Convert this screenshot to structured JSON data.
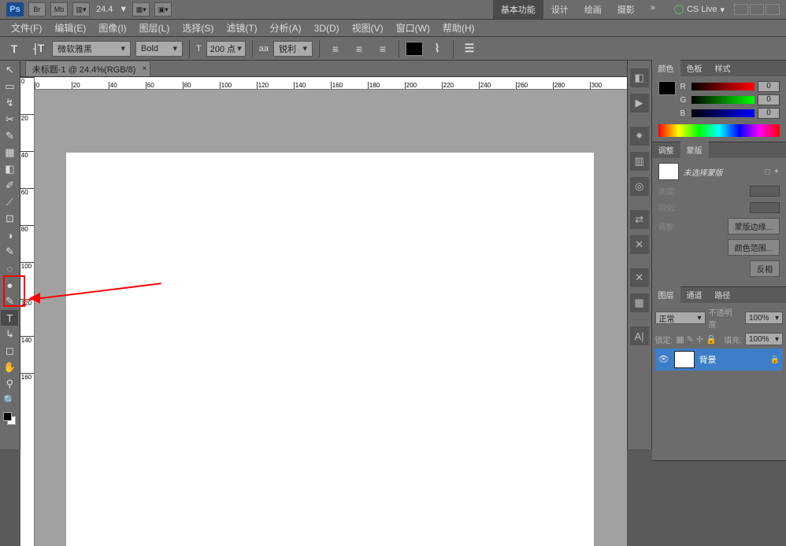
{
  "titlebar": {
    "app": "Ps",
    "btns": [
      "Br",
      "Mb"
    ],
    "zoom": "24.4",
    "arrow": "▼",
    "workspaces": [
      "基本功能",
      "设计",
      "绘画",
      "摄影"
    ],
    "more": "»",
    "cslive": "CS Live"
  },
  "menu": [
    "文件(F)",
    "编辑(E)",
    "图像(I)",
    "图层(L)",
    "选择(S)",
    "滤镜(T)",
    "分析(A)",
    "3D(D)",
    "视图(V)",
    "窗口(W)",
    "帮助(H)"
  ],
  "options": {
    "tool": "T",
    "orient": "⸡T",
    "font_family": "微软雅黑",
    "font_style": "Bold",
    "size_icon": "T",
    "size": "200 点",
    "aa_icon": "aa",
    "aa": "锐利",
    "align": [
      "≡",
      "≡",
      "≡"
    ],
    "warp": "⌇",
    "panel": "☰"
  },
  "doc": {
    "tab": "未标题-1 @ 24.4%(RGB/8)",
    "hruler": [
      0,
      20,
      40,
      60,
      80,
      100,
      120,
      140,
      160,
      180,
      200,
      220,
      240,
      260,
      280,
      300
    ],
    "vruler": [
      0,
      20,
      40,
      60,
      80,
      100,
      120,
      140,
      160
    ]
  },
  "tools": [
    "↖",
    "▭",
    "↯",
    "✂",
    "✎",
    "▦",
    "◧",
    "✐",
    "⟋",
    "⊡",
    "◑",
    "✎",
    "◌",
    "●",
    "◐",
    "✎",
    "T",
    "↳",
    "◻",
    "✋",
    "⚲",
    "🔍"
  ],
  "vstrip": [
    "◧",
    "▶",
    "✷",
    "▥",
    "◎",
    "⇄",
    "¶",
    "✕",
    "▦",
    "A|"
  ],
  "panels": {
    "color": {
      "tabs": [
        "颜色",
        "色板",
        "样式"
      ],
      "channels": [
        {
          "lbl": "R",
          "val": "0"
        },
        {
          "lbl": "G",
          "val": "0"
        },
        {
          "lbl": "B",
          "val": "0"
        }
      ]
    },
    "adjust": {
      "tabs": [
        "调整",
        "蒙版"
      ],
      "mask_label": "未选择蒙版",
      "rows": [
        {
          "label": "浓度:"
        },
        {
          "label": "羽化:"
        }
      ],
      "section": "调整:",
      "btns": [
        "蒙版边缘...",
        "颜色范围...",
        "反相"
      ]
    },
    "layers": {
      "tabs": [
        "图层",
        "通道",
        "路径"
      ],
      "blend": "正常",
      "opacity_label": "不透明度:",
      "opacity": "100%",
      "lock_label": "锁定:",
      "fill_label": "填充:",
      "fill": "100%",
      "layer": "背景"
    }
  }
}
